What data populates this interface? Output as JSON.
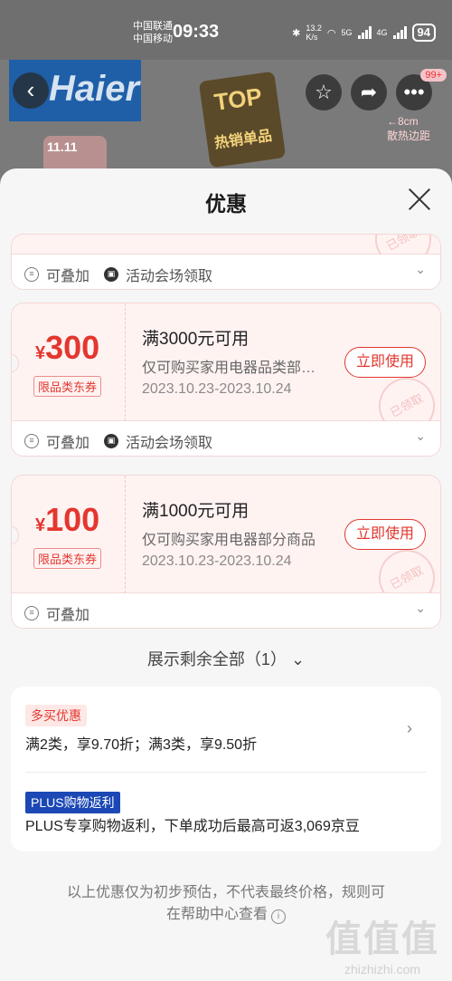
{
  "status_bar": {
    "carrier_1": "中国联通",
    "carrier_2": "中国移动",
    "time": "09:33",
    "speed": "13.2\nK/s",
    "network_1": "5G",
    "network_2": "4G",
    "battery": "94"
  },
  "product_header": {
    "brand": "Haier",
    "top_label": "TOP",
    "hot_label": "热销单品",
    "event_label": "11.11",
    "notification_badge": "99+",
    "size_label": "←8cm\n散热边距"
  },
  "sheet": {
    "title": "优惠"
  },
  "coupons": [
    {
      "partial": true,
      "foot_tags": [
        "可叠加",
        "活动会场领取"
      ],
      "stamp": "已领取"
    },
    {
      "currency": "¥",
      "amount": "300",
      "category_tag": "限品类东券",
      "condition": "满3000元可用",
      "scope": "仅可购买家用电器品类部…",
      "period": "2023.10.23-2023.10.24",
      "action": "立即使用",
      "stamp": "已领取",
      "foot_tags": [
        "可叠加",
        "活动会场领取"
      ]
    },
    {
      "currency": "¥",
      "amount": "100",
      "category_tag": "限品类东券",
      "condition": "满1000元可用",
      "scope": "仅可购买家用电器部分商品",
      "period": "2023.10.23-2023.10.24",
      "action": "立即使用",
      "stamp": "已领取",
      "foot_tags": [
        "可叠加"
      ]
    }
  ],
  "show_more": "展示剩余全部（1）",
  "promotions": {
    "multi_buy_tag": "多买优惠",
    "multi_buy_text": "满2类，享9.70折；满3类，享9.50折",
    "plus_tag": "PLUS购物返利",
    "plus_text": "PLUS专享购物返利，下单成功后最高可返3,069京豆"
  },
  "disclaimer": {
    "line1": "以上优惠仅为初步预估，不代表最终价格，规则可",
    "line2": "在帮助中心查看"
  },
  "watermark": {
    "big": "值值值",
    "small": "zhizhizhi.com"
  }
}
